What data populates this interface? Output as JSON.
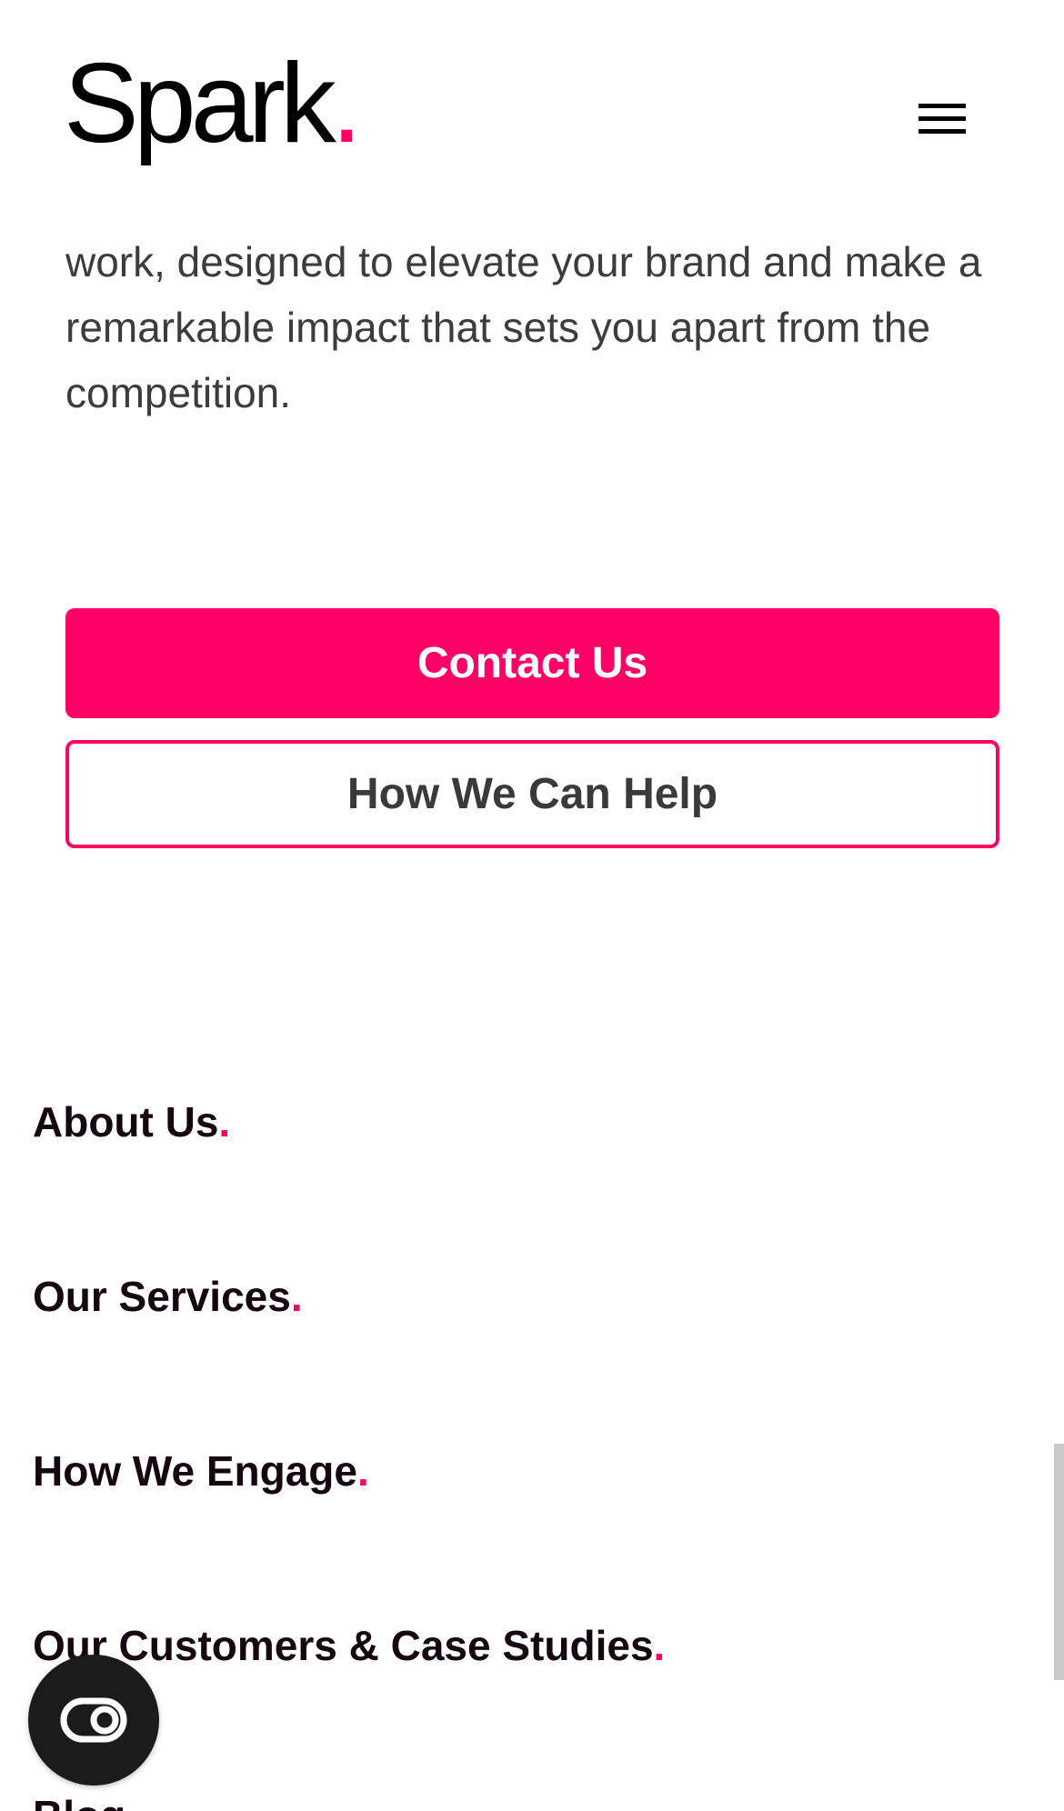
{
  "header": {
    "logo_text": "Spark",
    "logo_dot": ".",
    "menu_icon": "hamburger-menu-icon"
  },
  "intro": {
    "text": "work, designed to elevate your brand and make a remarkable impact that sets you apart from the competition."
  },
  "cta": {
    "primary_label": "Contact Us",
    "secondary_label": "How We Can Help"
  },
  "footer_nav": {
    "accent_char": ".",
    "items": [
      {
        "label": "About Us"
      },
      {
        "label": "Our Services"
      },
      {
        "label": "How We Engage"
      },
      {
        "label": "Our Customers & Case Studies"
      },
      {
        "label": "Blog"
      }
    ]
  },
  "accessibility_widget": {
    "icon": "accessibility-toggle-icon"
  },
  "colors": {
    "accent": "#ff0066",
    "text_dark": "#15060f",
    "text_body": "#3c3c3c",
    "background": "#ffffff",
    "widget_bg": "#1b1b1b"
  }
}
